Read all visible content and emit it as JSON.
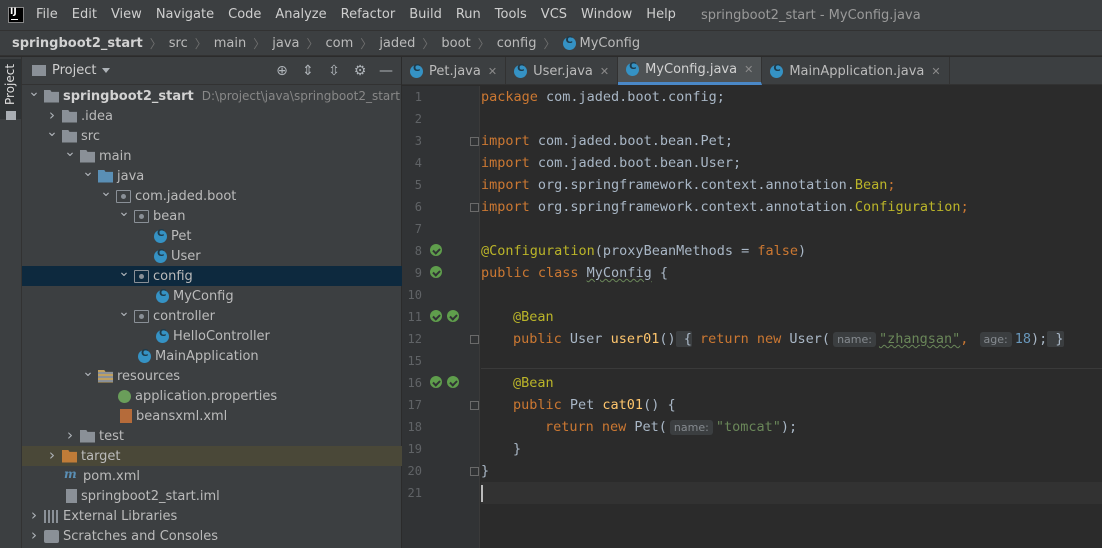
{
  "menu": {
    "items": [
      "File",
      "Edit",
      "View",
      "Navigate",
      "Code",
      "Analyze",
      "Refactor",
      "Build",
      "Run",
      "Tools",
      "VCS",
      "Window",
      "Help"
    ],
    "window_title": "springboot2_start - MyConfig.java"
  },
  "breadcrumb": [
    "springboot2_start",
    "src",
    "main",
    "java",
    "com",
    "jaded",
    "boot",
    "config",
    "MyConfig"
  ],
  "side_strip": {
    "project_tab": "Project"
  },
  "project_panel": {
    "title": "Project",
    "root_name": "springboot2_start",
    "root_path": "D:\\project\\java\\springboot2_start",
    "nodes": {
      "idea": ".idea",
      "src": "src",
      "main": "main",
      "java": "java",
      "package": "com.jaded.boot",
      "bean": "bean",
      "pet": "Pet",
      "user": "User",
      "config": "config",
      "myconfig": "MyConfig",
      "controller": "controller",
      "hellocontroller": "HelloController",
      "mainapplication": "MainApplication",
      "resources": "resources",
      "app_props": "application.properties",
      "beansxml": "beansxml.xml",
      "test": "test",
      "target": "target",
      "pom": "pom.xml",
      "iml": "springboot2_start.iml",
      "external_libs": "External Libraries",
      "scratches": "Scratches and Consoles"
    }
  },
  "editor": {
    "tabs": [
      {
        "label": "Pet.java",
        "active": false
      },
      {
        "label": "User.java",
        "active": false
      },
      {
        "label": "MyConfig.java",
        "active": true
      },
      {
        "label": "MainApplication.java",
        "active": false
      }
    ],
    "line_numbers": [
      "1",
      "2",
      "3",
      "4",
      "5",
      "6",
      "7",
      "8",
      "9",
      "10",
      "11",
      "12",
      "15",
      "16",
      "17",
      "18",
      "19",
      "20",
      "21"
    ],
    "code": {
      "l1_kw": "package",
      "l1_rest": " com.jaded.boot.config;",
      "l3_kw": "import",
      "l3_rest": " com.jaded.boot.bean.Pet;",
      "l4_kw": "import",
      "l4_rest": " com.jaded.boot.bean.User;",
      "l5_kw": "import",
      "l5_rest": " org.springframework.context.annotation.",
      "l5_ann": "Bean",
      "l5_end": ";",
      "l6_kw": "import",
      "l6_rest": " org.springframework.context.annotation.",
      "l6_ann": "Configuration",
      "l6_end": ";",
      "l8_ann": "@Configuration",
      "l8_rest": "(proxyBeanMethods = ",
      "l8_kw": "false",
      "l8_end": ")",
      "l9_kw": "public class ",
      "l9_name": "MyConfig",
      "l9_end": " {",
      "l11_ann": "@Bean",
      "l12_kw1": "public",
      "l12_type": " User ",
      "l12_fn": "user01",
      "l12_paren": "()",
      "l12_open": " {",
      "l12_ret": " return new",
      "l12_ctor": " User(",
      "l12_hint1": "name:",
      "l12_str": "\"zhangsan\"",
      "l12_comma": ",",
      "l12_hint2": "age:",
      "l12_num": "18",
      "l12_end": ");",
      "l12_close": " }",
      "l16_ann": "@Bean",
      "l17_kw1": "public",
      "l17_type": " Pet ",
      "l17_fn": "cat01",
      "l17_end": "() {",
      "l18_kw": "return new",
      "l18_ctor": " Pet(",
      "l18_hint": "name:",
      "l18_str": "\"tomcat\"",
      "l18_end": ");",
      "l19": "}",
      "l20": "}"
    }
  },
  "colors": {
    "keyword": "#cc7832",
    "annotation": "#bbb529",
    "string": "#6a8759",
    "number": "#6897bb",
    "method": "#ffc66d",
    "selection": "#0d293e",
    "tab_underline": "#4a88c7"
  }
}
